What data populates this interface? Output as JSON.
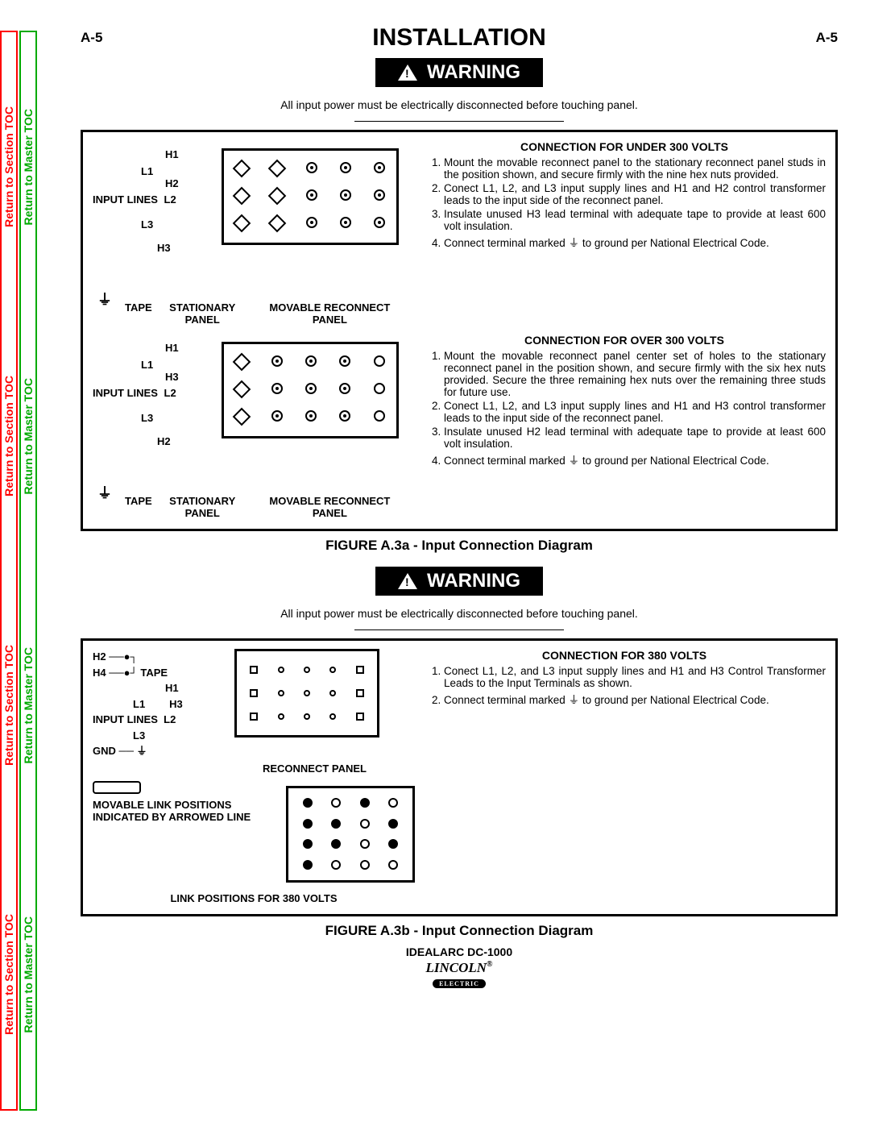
{
  "sidebar": {
    "section_toc": "Return to Section TOC",
    "master_toc": "Return to Master TOC"
  },
  "header": {
    "page_left": "A-5",
    "title": "INSTALLATION",
    "page_right": "A-5"
  },
  "warning": {
    "label": "WARNING",
    "text": "All input power must be electrically disconnected before touching panel."
  },
  "figA": {
    "diagram_under": {
      "h1": "H1",
      "l1": "L1",
      "h2": "H2",
      "input_lines": "INPUT LINES",
      "l2": "L2",
      "l3": "L3",
      "h3": "H3",
      "tape": "TAPE",
      "stationary": "STATIONARY PANEL",
      "movable": "MOVABLE RECONNECT PANEL"
    },
    "diagram_over": {
      "h1": "H1",
      "l1": "L1",
      "h3": "H3",
      "input_lines": "INPUT LINES",
      "l2": "L2",
      "l3": "L3",
      "h2": "H2",
      "tape": "TAPE",
      "stationary": "STATIONARY PANEL",
      "movable": "MOVABLE RECONNECT PANEL"
    },
    "under": {
      "title": "CONNECTION FOR UNDER 300 VOLTS",
      "i1": "Mount the movable reconnect panel to the stationary reconnect panel studs in the position shown, and secure firmly with the nine hex nuts provided.",
      "i2": "Conect L1, L2, and L3 input supply lines and H1 and H2 control transformer leads to the input side of the reconnect panel.",
      "i3": "Insulate unused H3 lead terminal with adequate tape to provide at least 600 volt insulation.",
      "i4a": "Connect terminal marked ",
      "i4b": " to ground per National Electrical Code."
    },
    "over": {
      "title": "CONNECTION FOR OVER 300 VOLTS",
      "i1": "Mount the movable reconnect panel center set of holes to the stationary reconnect panel in the position shown, and secure firmly with the six hex nuts provided. Secure the three remaining hex nuts over the remaining three studs for future use.",
      "i2": "Conect L1, L2, and L3 input supply lines and H1 and H3 control transformer leads to the input side of the reconnect panel.",
      "i3": "Insulate unused H2 lead terminal with adequate tape to provide at least 600 volt insulation.",
      "i4a": "Connect terminal marked ",
      "i4b": " to ground per National Electrical Code."
    },
    "caption": "FIGURE A.3a - Input Connection Diagram"
  },
  "figB": {
    "diagram": {
      "h2": "H2",
      "h4": "H4",
      "tape": "TAPE",
      "h1": "H1",
      "l1": "L1",
      "h3": "H3",
      "input_lines": "INPUT LINES",
      "l2": "L2",
      "l3": "L3",
      "gnd": "GND",
      "reconnect_panel": "RECONNECT PANEL",
      "movable_link": "MOVABLE LINK POSITIONS INDICATED BY ARROWED LINE",
      "link_positions": "LINK POSITIONS FOR 380 VOLTS"
    },
    "conn380": {
      "title": "CONNECTION FOR 380 VOLTS",
      "i1": "Conect L1, L2, and L3 input supply lines and H1 and H3 Control Transformer Leads to the Input Terminals as shown.",
      "i2a": "Connect terminal marked ",
      "i2b": " to ground per National Electrical Code."
    },
    "caption": "FIGURE A.3b - Input Connection Diagram"
  },
  "footer": {
    "model": "IDEALARC DC-1000",
    "brand": "LINCOLN",
    "brand_sub": "ELECTRIC",
    "reg": "®"
  },
  "gnd_symbol": "⏚"
}
